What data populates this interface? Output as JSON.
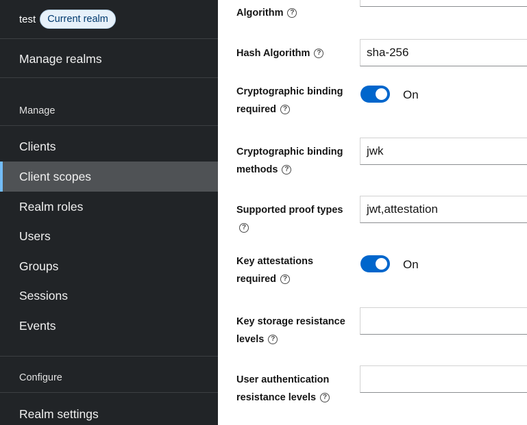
{
  "sidebar": {
    "realm_name": "test",
    "realm_badge": "Current realm",
    "manage_realms": "Manage realms",
    "manage_section": "Manage",
    "items": [
      "Clients",
      "Client scopes",
      "Realm roles",
      "Users",
      "Groups",
      "Sessions",
      "Events"
    ],
    "active_item": "Client scopes",
    "configure_section": "Configure",
    "realm_settings": "Realm settings"
  },
  "form": {
    "algorithm_label": "Algorithm",
    "hash_algorithm_label": "Hash Algorithm",
    "hash_algorithm_value": "sha-256",
    "crypto_binding_required_label_1": "Cryptographic binding",
    "crypto_binding_required_label_2": "required",
    "crypto_binding_required_state": "On",
    "crypto_binding_methods_label_1": "Cryptographic binding",
    "crypto_binding_methods_label_2": "methods",
    "crypto_binding_methods_value": "jwk",
    "proof_types_label": "Supported proof types",
    "proof_types_value": "jwt,attestation",
    "key_attestations_label_1": "Key attestations",
    "key_attestations_label_2": "required",
    "key_attestations_state": "On",
    "key_storage_label_1": "Key storage resistance",
    "key_storage_label_2": "levels",
    "key_storage_value": "",
    "user_auth_label_1": "User authentication",
    "user_auth_label_2": "resistance levels",
    "user_auth_value": ""
  },
  "icons": {
    "help": "help-circle-icon"
  },
  "colors": {
    "sidebar_bg": "#212427",
    "active_bg": "#4f5255",
    "active_accent": "#73bcf7",
    "toggle_on": "#0066cc"
  }
}
